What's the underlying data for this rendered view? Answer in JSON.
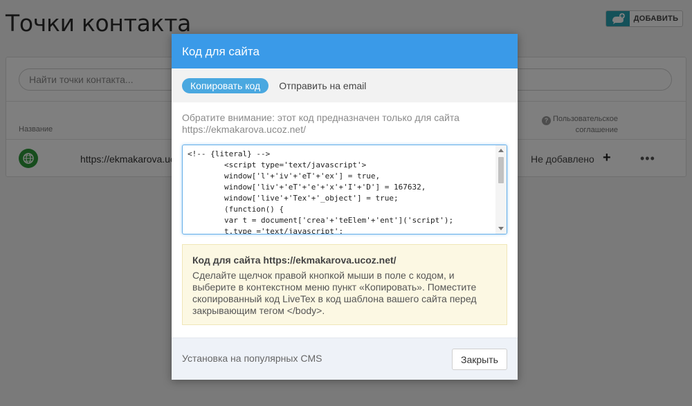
{
  "page": {
    "title": "Точки контакта",
    "add_button": "ДОБАВИТЬ",
    "search_placeholder": "Найти точки контакта...",
    "columns": {
      "name": "Название",
      "agreement": "Пользовательское соглашение"
    },
    "rows": [
      {
        "url": "https://ekmakarova.uc",
        "status": "Не добавлено",
        "add": "+",
        "more": "•••"
      }
    ]
  },
  "modal": {
    "title": "Код для сайта",
    "tabs": [
      {
        "label": "Копировать код",
        "active": true
      },
      {
        "label": "Отправить на email",
        "active": false
      }
    ],
    "notice": "Обратите внимание: этот код предназначен только для сайта https://ekmakarova.ucoz.net/",
    "code": "<!-- {literal} -->\n        <script type='text/javascript'>\n        window['l'+'iv'+'eT'+'ex'] = true,\n        window['liv'+'eT'+'e'+'x'+'I'+'D'] = 167632,\n        window['live'+'Tex'+'_object'] = true;\n        (function() {\n        var t = document['crea'+'teElem'+'ent']('script');\n        t.type ='text/javascript';",
    "info": {
      "title": "Код для сайта https://ekmakarova.ucoz.net/",
      "text": "Сделайте щелчок правой кнопкой мыши в поле с кодом, и выберите в контекстном меню пункт «Копировать». Поместите скопированный код LiveTex в код шаблона вашего сайта перед закрывающим тегом </body>."
    },
    "footer": {
      "cms_link": "Установка на популярных CMS",
      "close_button": "Закрыть"
    }
  },
  "colors": {
    "header": "#3a9ae8",
    "active_tab": "#4aa8e0",
    "info_bg": "#fcf8e3",
    "add_icon": "#29a3b3",
    "row_icon": "#2e9a3a"
  }
}
